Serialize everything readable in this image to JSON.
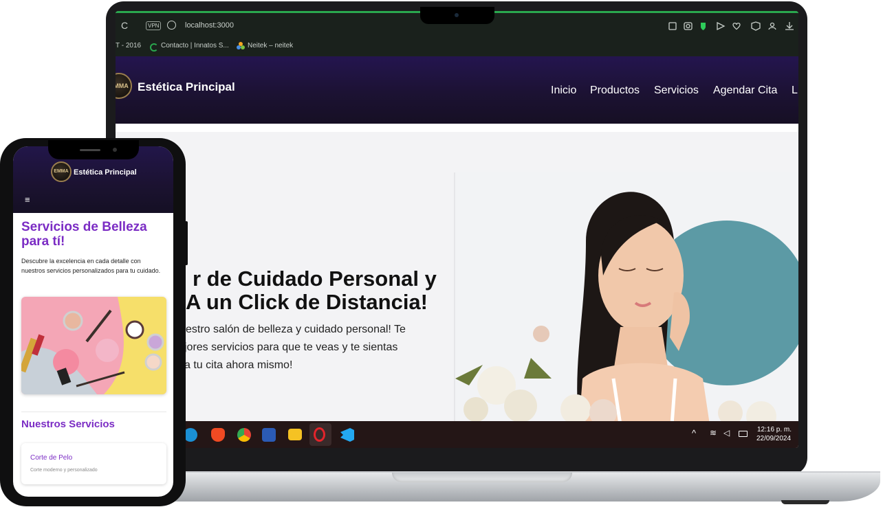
{
  "browser": {
    "url": "localhost:3000",
    "vpn_label": "VPN",
    "bookmarks": [
      "T - 2016",
      "Contacto | Innatos S...",
      "Neitek – neitek"
    ]
  },
  "laptop_site": {
    "logo_text": "EMMA",
    "brand": "Estética Principal",
    "nav": [
      "Inicio",
      "Productos",
      "Servicios",
      "Agendar Cita",
      "L"
    ],
    "hero_title_line1": "r de Cuidado Personal y",
    "hero_title_line2": "A un Click de Distancia!",
    "hero_text_line1": "estro salón de belleza y cuidado personal! Te",
    "hero_text_line2": "jores servicios para que te veas y te sientas",
    "hero_text_line3": "a tu cita ahora mismo!"
  },
  "taskbar": {
    "time": "12:16 p. m.",
    "date": "22/09/2024"
  },
  "phone_site": {
    "logo_text": "EMMA",
    "brand": "Estética Principal",
    "menu_icon": "≡",
    "hero_title": "Servicios de Belleza para tí!",
    "hero_text": "Descubre la excelencia en cada detalle con nuestros servicios personalizados para tu cuidado.",
    "services_heading": "Nuestros Servicios",
    "service_name": "Corte de Pelo",
    "service_desc": "Corte moderno y personalizado"
  },
  "colors": {
    "accent_purple": "#7b2cc4",
    "header_dark": "#1c1233",
    "browser_green": "#2aa84e"
  },
  "icons": [
    "reload-icon",
    "globe-icon",
    "share-icon",
    "camera-icon",
    "shield-icon",
    "send-icon",
    "heart-icon",
    "box-icon",
    "user-icon",
    "download-icon",
    "hamburger-menu-icon",
    "wifi-icon",
    "volume-icon",
    "battery-icon",
    "chevron-up-icon"
  ]
}
